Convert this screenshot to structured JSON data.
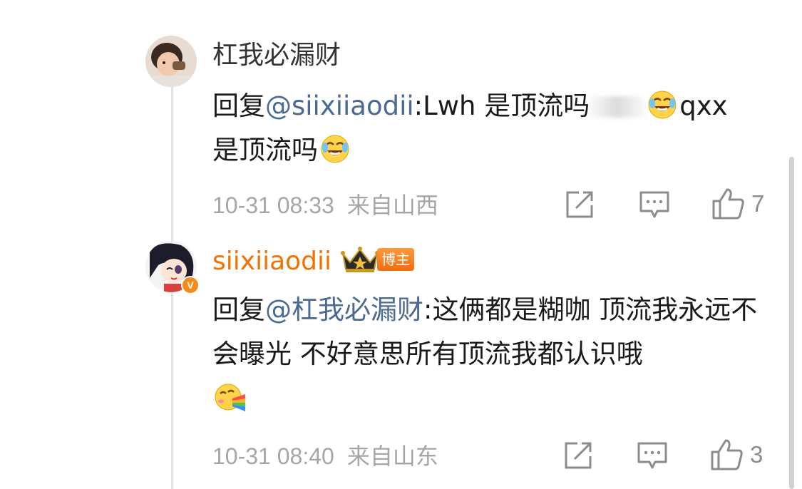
{
  "comments": [
    {
      "username": "杠我必漏财",
      "reply_prefix": "回复",
      "mention": "@siixiiaodii",
      "text_part1": ":Lwh 是顶流吗",
      "text_part2": "qxx",
      "text_part3": "是顶流吗",
      "emoji": "laugh-cry-emoji",
      "time": "10-31 08:33",
      "location": "来自山西",
      "like_count": "7"
    },
    {
      "username": "siixiiaodii",
      "host_badge": "博主",
      "verified_mark": "V",
      "reply_prefix": "回复",
      "mention": "@杠我必漏财",
      "text_part1": ":这俩都是糊咖 顶流我永远不会曝光 不好意思所有顶流我都认识哦",
      "emoji": "rainbow-puke-emoji",
      "time": "10-31 08:40",
      "location": "来自山东",
      "like_count": "3"
    }
  ],
  "icons": {
    "share": "share-icon",
    "comment": "comment-icon",
    "like": "thumbs-up-icon",
    "crown": "crown-icon"
  },
  "colors": {
    "mention": "#4a6a93",
    "host_name": "#f27200",
    "meta": "#a6a6a6",
    "thread_line": "#e3e3e3"
  }
}
